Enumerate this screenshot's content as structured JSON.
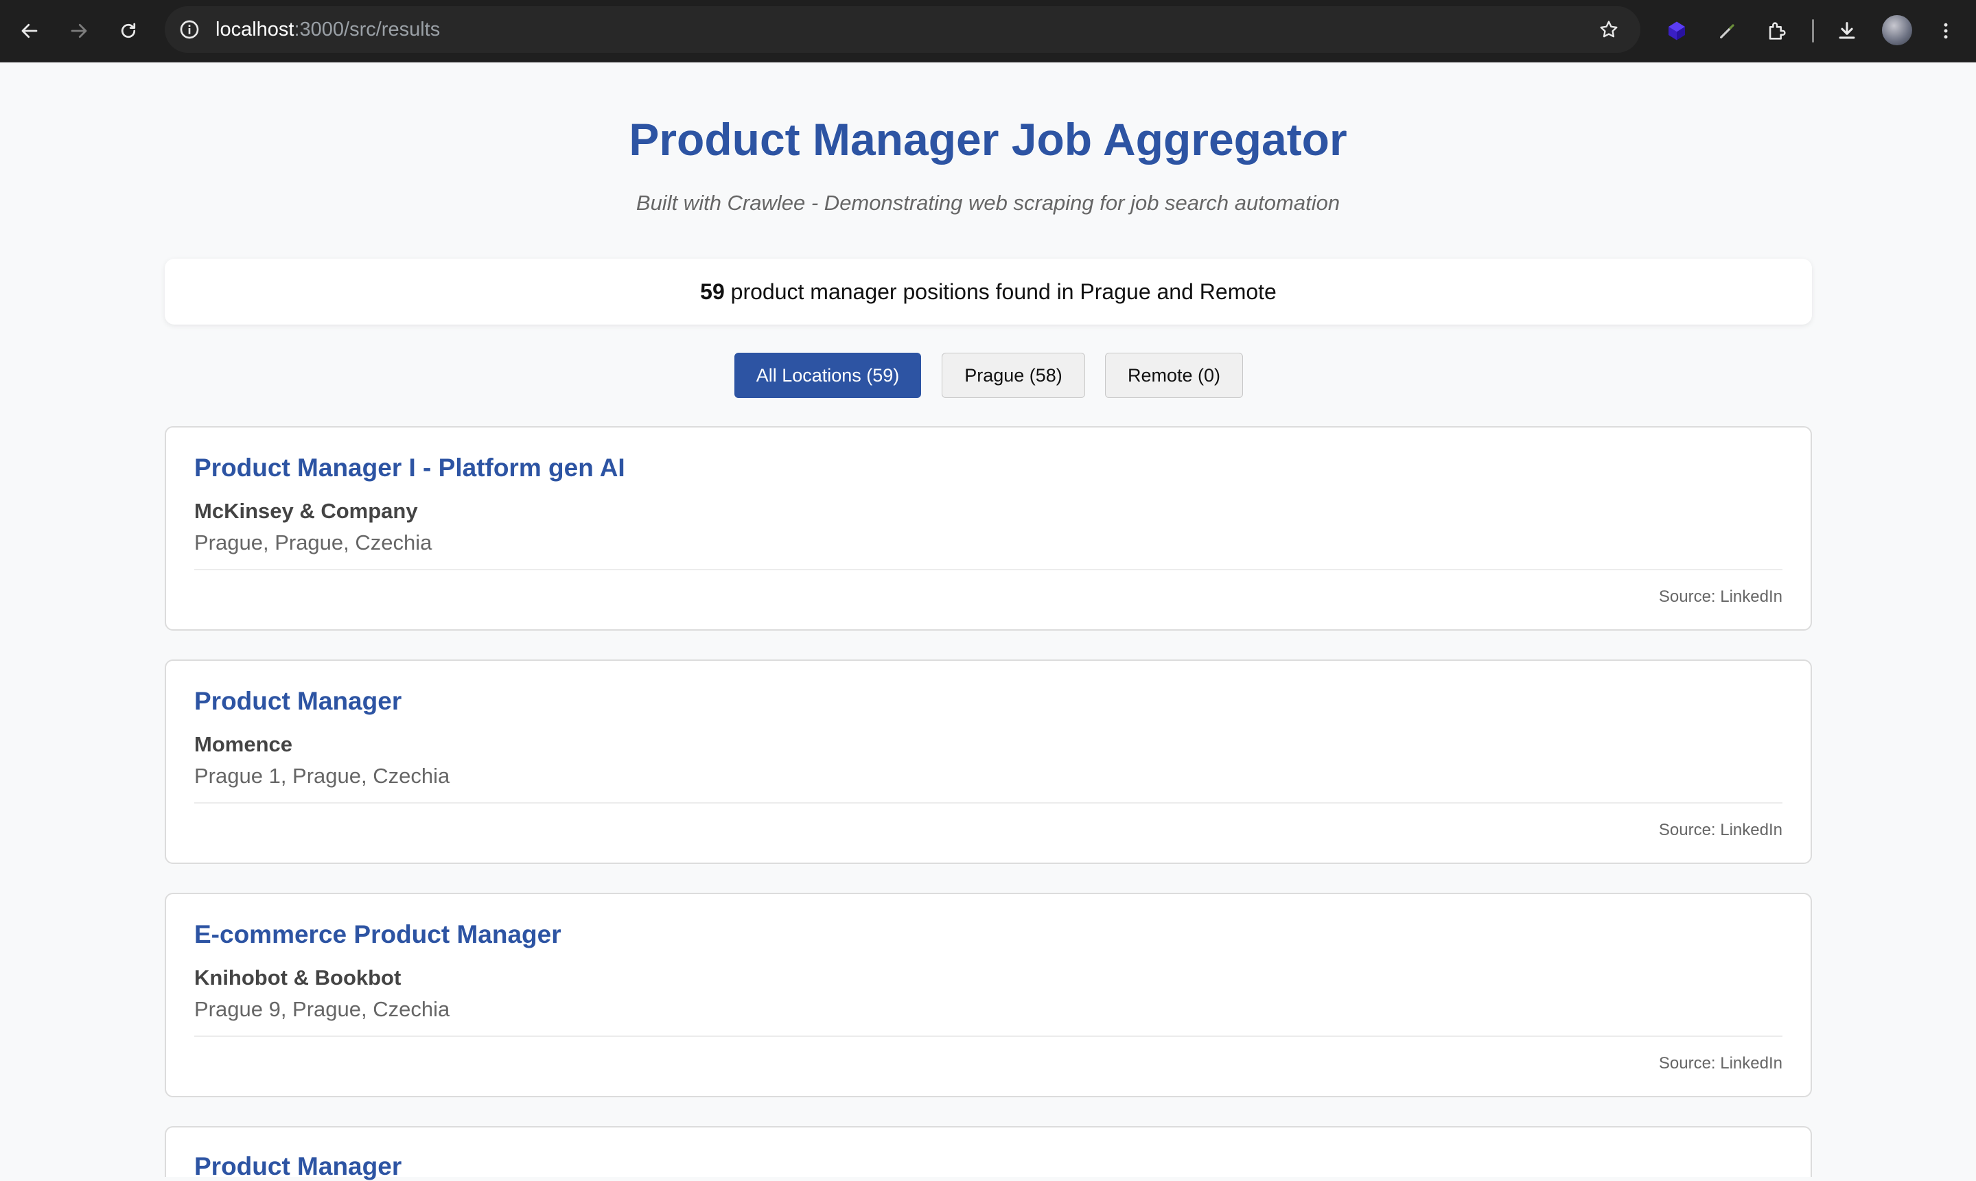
{
  "browser": {
    "url_host": "localhost",
    "url_path": ":3000/src/results"
  },
  "header": {
    "title": "Product Manager Job Aggregator",
    "subtitle": "Built with Crawlee - Demonstrating web scraping for job search automation"
  },
  "summary": {
    "count": "59",
    "text": " product manager positions found in Prague and Remote"
  },
  "filters": [
    {
      "label": "All Locations (59)",
      "active": true
    },
    {
      "label": "Prague (58)",
      "active": false
    },
    {
      "label": "Remote (0)",
      "active": false
    }
  ],
  "jobs": [
    {
      "title": "Product Manager I - Platform gen AI",
      "company": "McKinsey & Company",
      "location": "Prague, Prague, Czechia",
      "source": "Source: LinkedIn"
    },
    {
      "title": "Product Manager",
      "company": "Momence",
      "location": "Prague 1, Prague, Czechia",
      "source": "Source: LinkedIn"
    },
    {
      "title": "E-commerce Product Manager",
      "company": "Knihobot & Bookbot",
      "location": "Prague 9, Prague, Czechia",
      "source": "Source: LinkedIn"
    },
    {
      "title": "Product Manager",
      "company": "",
      "location": "",
      "source": ""
    }
  ],
  "colors": {
    "accent": "#2d54a3",
    "background": "#f8f9fa",
    "chrome": "#1f1f1f"
  }
}
